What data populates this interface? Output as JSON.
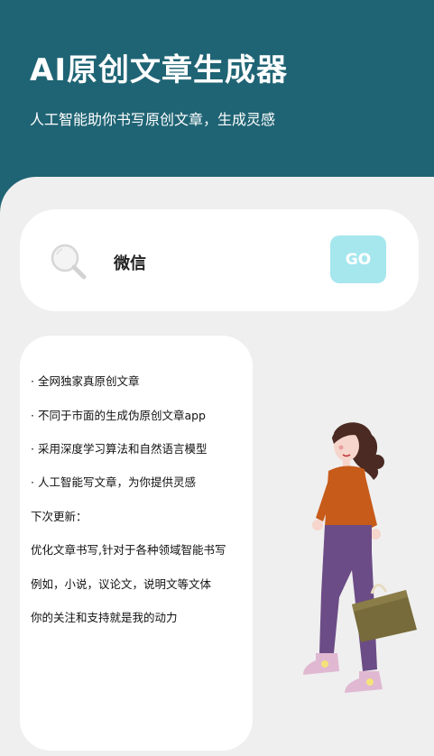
{
  "header": {
    "title": "AI原创文章生成器",
    "subtitle": "人工智能助你书写原创文章，生成灵感"
  },
  "search": {
    "value": "微信",
    "go_label": "GO",
    "icon": "search-icon"
  },
  "info": {
    "features": [
      "· 全网独家真原创文章",
      "· 不同于市面的生成伪原创文章app",
      "· 采用深度学习算法和自然语言模型",
      "· 人工智能写文章，为你提供灵感"
    ],
    "update_heading": "下次更新：",
    "update_lines": [
      "优化文章书写,针对于各种领域智能书写",
      "例如，小说，议论文，说明文等文体",
      "你的关注和支持就是我的动力"
    ]
  },
  "colors": {
    "header_bg": "#1f6474",
    "panel_bg": "#efefef",
    "go_button": "#a6e7ee"
  }
}
